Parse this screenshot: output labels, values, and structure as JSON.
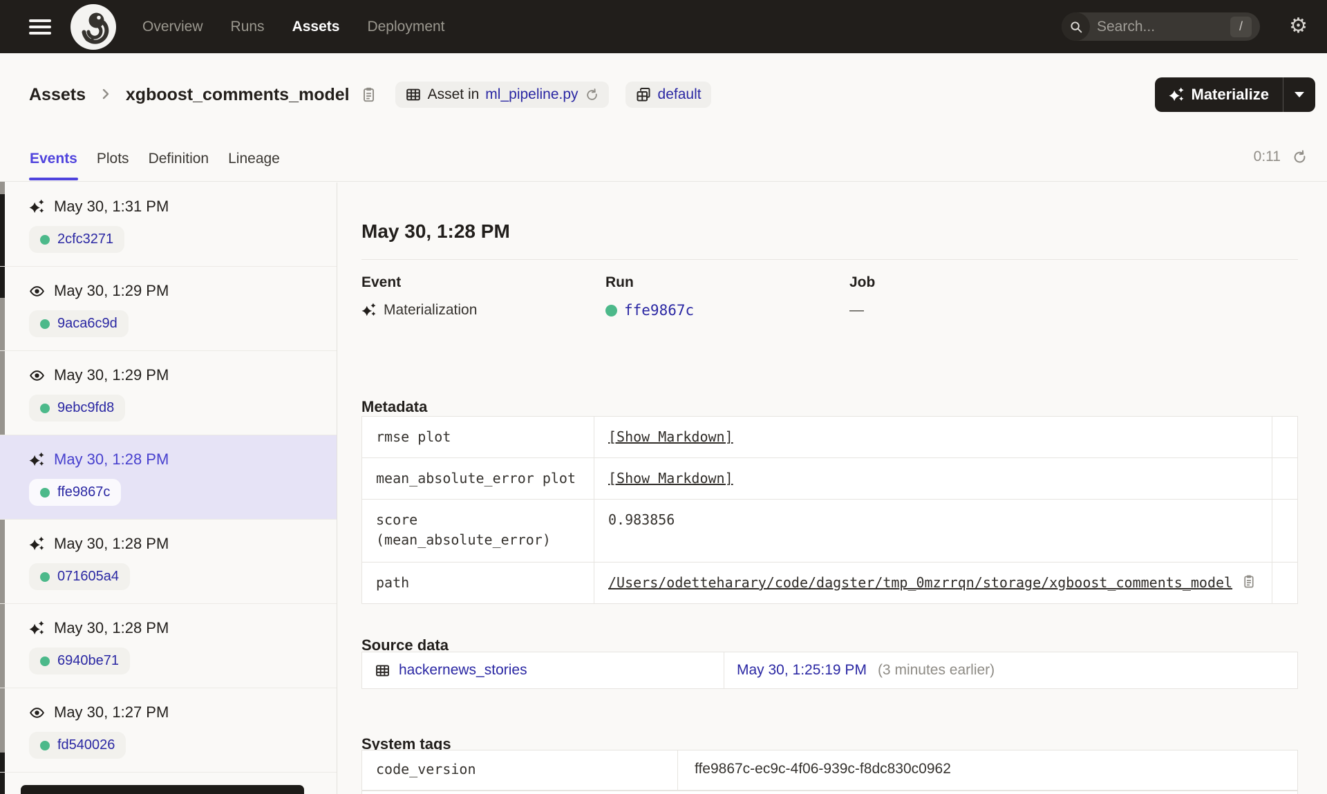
{
  "nav": {
    "items": [
      "Overview",
      "Runs",
      "Assets",
      "Deployment"
    ],
    "active_item": "Assets",
    "search": {
      "placeholder": "Search...",
      "shortcut": "/"
    }
  },
  "header": {
    "breadcrumb": {
      "root": "Assets",
      "current": "xgboost_comments_model"
    },
    "badges": {
      "asset_in_prefix": "Asset in",
      "asset_in_file": "ml_pipeline.py",
      "group_name": "default"
    },
    "materialize_label": "Materialize"
  },
  "tabs": {
    "items": [
      "Events",
      "Plots",
      "Definition",
      "Lineage"
    ],
    "active": "Events",
    "auto_refresh_timer": "0:11"
  },
  "sidebar": {
    "events": [
      {
        "icon": "materialization",
        "time": "May 30, 1:31 PM",
        "run_id": "2cfc3271",
        "selected": false
      },
      {
        "icon": "observation",
        "time": "May 30, 1:29 PM",
        "run_id": "9aca6c9d",
        "selected": false
      },
      {
        "icon": "observation",
        "time": "May 30, 1:29 PM",
        "run_id": "9ebc9fd8",
        "selected": false
      },
      {
        "icon": "materialization",
        "time": "May 30, 1:28 PM",
        "run_id": "ffe9867c",
        "selected": true
      },
      {
        "icon": "materialization",
        "time": "May 30, 1:28 PM",
        "run_id": "071605a4",
        "selected": false
      },
      {
        "icon": "materialization",
        "time": "May 30, 1:28 PM",
        "run_id": "6940be71",
        "selected": false
      },
      {
        "icon": "observation",
        "time": "May 30, 1:27 PM",
        "run_id": "fd540026",
        "selected": false
      }
    ]
  },
  "detail": {
    "title": "May 30, 1:28 PM",
    "summary": {
      "event_label": "Event",
      "event_value": "Materialization",
      "run_label": "Run",
      "run_id": "ffe9867c",
      "job_label": "Job",
      "job_value": "—"
    },
    "metadata": {
      "heading": "Metadata",
      "rows": [
        {
          "key": "rmse plot",
          "value": "[Show Markdown]"
        },
        {
          "key": "mean_absolute_error plot",
          "value": "[Show Markdown]"
        },
        {
          "key": "score (mean_absolute_error)",
          "value": "0.983856"
        },
        {
          "key": "path",
          "value": "/Users/odetteharary/code/dagster/tmp_0mzrrqn/storage/xgboost_comments_model"
        }
      ]
    },
    "source_data": {
      "heading": "Source data",
      "asset_name": "hackernews_stories",
      "timestamp": "May 30, 1:25:19 PM",
      "note": "(3 minutes earlier)"
    },
    "system_tags": {
      "heading": "System tags",
      "rows": [
        {
          "key": "code_version",
          "value": "ffe9867c-ec9c-4f06-939c-f8dc830c0962"
        }
      ]
    }
  },
  "colors": {
    "accent_purple": "#4F43DD",
    "link_blue": "#2A27A3",
    "success_green": "#4CB98A",
    "nav_background": "#211E1B"
  }
}
